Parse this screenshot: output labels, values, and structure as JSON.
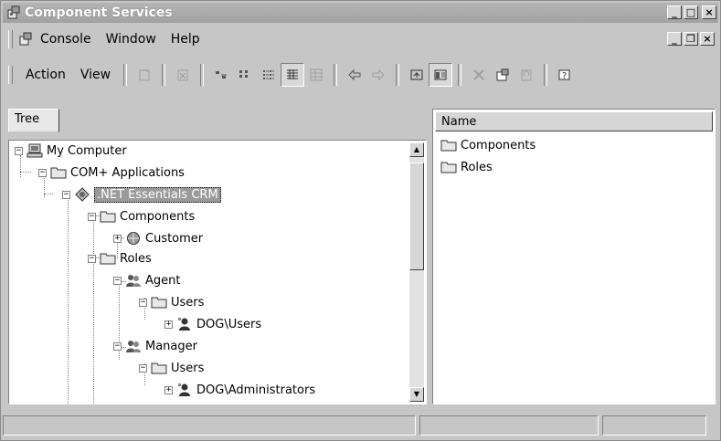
{
  "window": {
    "title": "Component Services",
    "app_icon": "component-services-icon"
  },
  "title_buttons": {
    "minimize": "_",
    "maximize": "□",
    "close": "×"
  },
  "menubar": {
    "items": [
      {
        "label": "Console",
        "icon": "console-icon"
      },
      {
        "label": "Window"
      },
      {
        "label": "Help"
      }
    ],
    "mdi_buttons": {
      "minimize": "_",
      "restore": "❐",
      "close": "×"
    }
  },
  "toolbar": {
    "menus": [
      {
        "label": "Action"
      },
      {
        "label": "View"
      }
    ],
    "buttons": [
      "new-icon",
      "delete-icon",
      "large-icons-icon",
      "small-icons-icon",
      "list-icon",
      "details-icon",
      "properties-grid-icon",
      "back-icon",
      "forward-icon",
      "up-one-level-icon",
      "show-hide-tree-icon",
      "delete-x-icon",
      "properties-icon",
      "refresh-icon",
      "help-icon"
    ]
  },
  "left_pane": {
    "tab_label": "Tree",
    "tree": [
      {
        "label": "My Computer",
        "icon": "computer-icon",
        "expander": "−"
      },
      {
        "label": "COM+ Applications",
        "icon": "folder-icon",
        "expander": "−"
      },
      {
        "label": ".NET Essentials CRM",
        "icon": "com-app-icon",
        "expander": "−",
        "selected": true
      },
      {
        "label": "Components",
        "icon": "folder-icon",
        "expander": "−"
      },
      {
        "label": "Customer",
        "icon": "component-icon",
        "expander": "+"
      },
      {
        "label": "Roles",
        "icon": "folder-icon",
        "expander": "−"
      },
      {
        "label": "Agent",
        "icon": "role-icon",
        "expander": "−"
      },
      {
        "label": "Users",
        "icon": "folder-icon",
        "expander": "−"
      },
      {
        "label": "DOG\\Users",
        "icon": "user-icon",
        "expander": "+"
      },
      {
        "label": "Manager",
        "icon": "role-icon",
        "expander": "−"
      },
      {
        "label": "Users",
        "icon": "folder-icon",
        "expander": "−"
      },
      {
        "label": "DOG\\Administrators",
        "icon": "user-icon",
        "expander": "+"
      }
    ]
  },
  "right_pane": {
    "column_header": "Name",
    "items": [
      {
        "label": "Components",
        "icon": "folder-icon"
      },
      {
        "label": "Roles",
        "icon": "folder-icon"
      }
    ]
  },
  "status_bar": {
    "panels": [
      "",
      "",
      ""
    ]
  }
}
